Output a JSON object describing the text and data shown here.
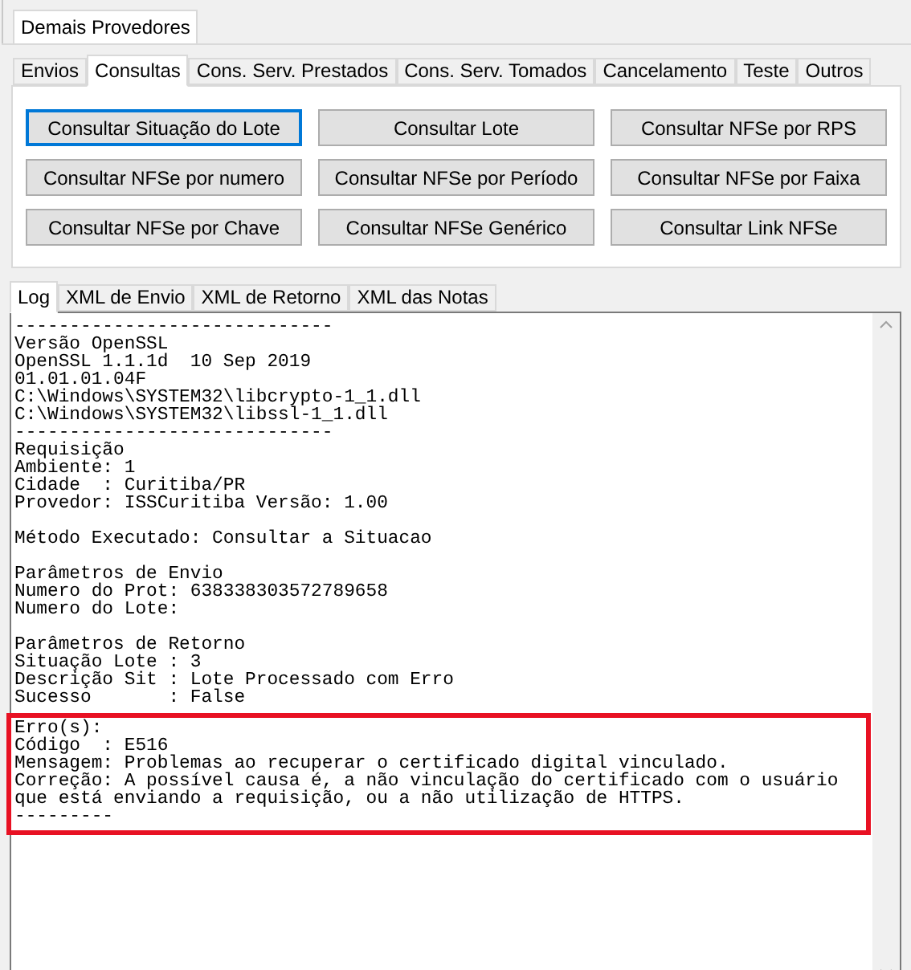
{
  "top_tabs": [
    {
      "label": "Demais Provedores",
      "selected": true
    }
  ],
  "tabs": [
    {
      "label": "Envios",
      "selected": false
    },
    {
      "label": "Consultas",
      "selected": true
    },
    {
      "label": "Cons. Serv. Prestados",
      "selected": false
    },
    {
      "label": "Cons. Serv. Tomados",
      "selected": false
    },
    {
      "label": "Cancelamento",
      "selected": false
    },
    {
      "label": "Teste",
      "selected": false
    },
    {
      "label": "Outros",
      "selected": false
    }
  ],
  "buttons": [
    {
      "label": "Consultar Situação do Lote",
      "focused": true
    },
    {
      "label": "Consultar Lote",
      "focused": false
    },
    {
      "label": "Consultar NFSe por RPS",
      "focused": false
    },
    {
      "label": "Consultar NFSe por numero",
      "focused": false
    },
    {
      "label": "Consultar NFSe por Período",
      "focused": false
    },
    {
      "label": "Consultar NFSe por Faixa",
      "focused": false
    },
    {
      "label": "Consultar NFSe por Chave",
      "focused": false
    },
    {
      "label": "Consultar NFSe Genérico",
      "focused": false
    },
    {
      "label": "Consultar Link NFSe",
      "focused": false
    }
  ],
  "log_tabs": [
    {
      "label": "Log",
      "selected": true
    },
    {
      "label": "XML de Envio",
      "selected": false
    },
    {
      "label": "XML de Retorno",
      "selected": false
    },
    {
      "label": "XML das Notas",
      "selected": false
    }
  ],
  "log": {
    "blocks": [
      {
        "highlighted": false,
        "lines": [
          "-----------------------------",
          "Versão OpenSSL",
          "OpenSSL 1.1.1d  10 Sep 2019",
          "01.01.01.04F",
          "C:\\Windows\\SYSTEM32\\libcrypto-1_1.dll",
          "C:\\Windows\\SYSTEM32\\libssl-1_1.dll",
          "-----------------------------",
          "Requisição",
          "Ambiente: 1",
          "Cidade  : Curitiba/PR",
          "Provedor: ISSCuritiba Versão: 1.00"
        ]
      },
      {
        "highlighted": false,
        "lines": [
          "Método Executado: Consultar a Situacao"
        ]
      },
      {
        "highlighted": false,
        "lines": [
          "Parâmetros de Envio",
          "Numero do Prot: 638338303572789658",
          "Numero do Lote:"
        ]
      },
      {
        "highlighted": false,
        "lines": [
          "Parâmetros de Retorno",
          "Situação Lote : 3",
          "Descrição Sit : Lote Processado com Erro",
          "Sucesso       : False"
        ]
      },
      {
        "highlighted": true,
        "lines": [
          "Erro(s):",
          "Código  : E516",
          "Mensagem: Problemas ao recuperar o certificado digital vinculado.",
          "Correção: A possível causa é, a não vinculação do certificado com o usuário",
          "que está enviando a requisição, ou a não utilização de HTTPS.",
          "---------"
        ]
      }
    ]
  }
}
